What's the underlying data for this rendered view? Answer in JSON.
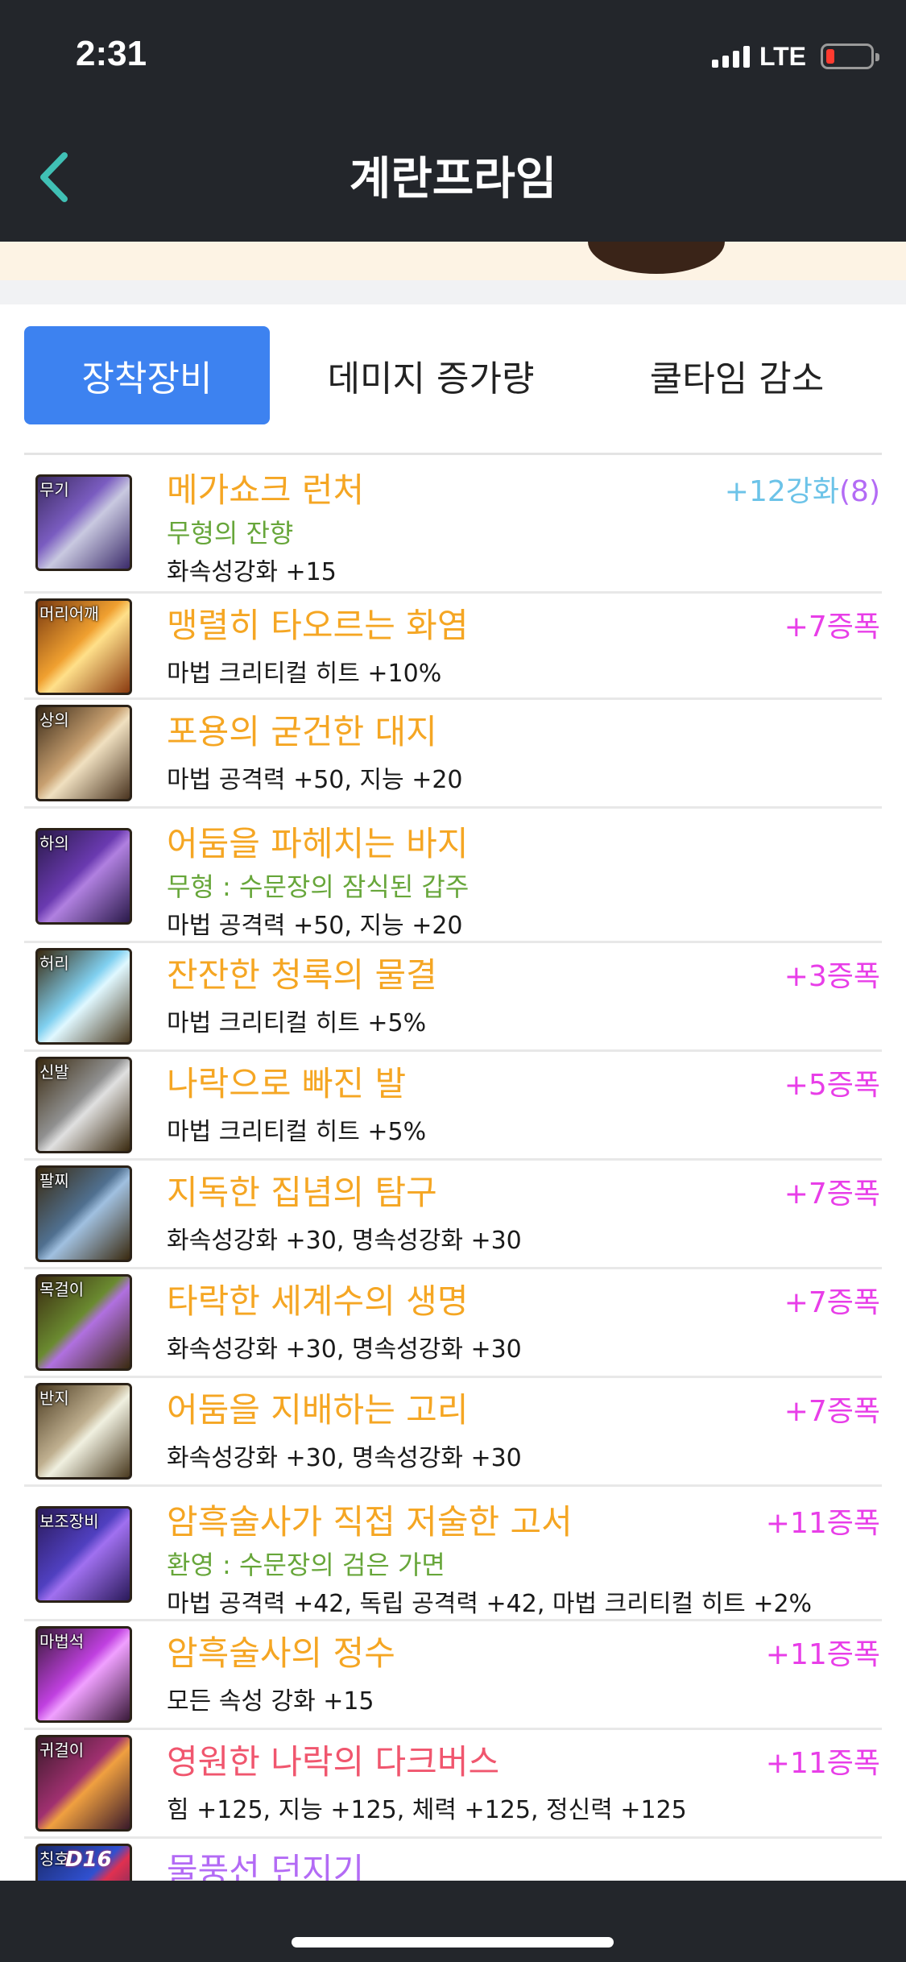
{
  "status": {
    "time": "2:31",
    "network": "LTE"
  },
  "nav": {
    "title": "계란프라임",
    "back_icon": "chevron-left-icon"
  },
  "tabs": [
    {
      "label": "장착장비",
      "active": true
    },
    {
      "label": "데미지 증가량",
      "active": false
    },
    {
      "label": "쿨타임 감소",
      "active": false
    }
  ],
  "colors": {
    "accent": "#3d82f0",
    "item_name_epic": "#f5a623",
    "item_name_legendary": "#f0566e",
    "item_name_rare": "#b36bf5",
    "sub_text": "#67a63a",
    "reinforce": "#6cc3e8",
    "amplify": "#e83ee8"
  },
  "equipment": [
    {
      "slot": "무기",
      "name": "메가쇼크 런처",
      "sub": "무형의 잔향",
      "stat": "화속성강화 +15",
      "grade": "+12강화",
      "grade_extra": "(8)"
    },
    {
      "slot": "머리어깨",
      "name": "맹렬히 타오르는 화염",
      "sub": "",
      "stat": "마법 크리티컬 히트 +10%",
      "grade": "+7증폭",
      "grade_extra": ""
    },
    {
      "slot": "상의",
      "name": "포용의 굳건한 대지",
      "sub": "",
      "stat": "마법 공격력 +50, 지능 +20",
      "grade": "",
      "grade_extra": ""
    },
    {
      "slot": "하의",
      "name": "어둠을 파헤치는 바지",
      "sub": "무형 : 수문장의 잠식된 갑주",
      "stat": "마법 공격력 +50, 지능 +20",
      "grade": "",
      "grade_extra": ""
    },
    {
      "slot": "허리",
      "name": "잔잔한 청록의 물결",
      "sub": "",
      "stat": "마법 크리티컬 히트 +5%",
      "grade": "+3증폭",
      "grade_extra": ""
    },
    {
      "slot": "신발",
      "name": "나락으로 빠진 발",
      "sub": "",
      "stat": "마법 크리티컬 히트 +5%",
      "grade": "+5증폭",
      "grade_extra": ""
    },
    {
      "slot": "팔찌",
      "name": "지독한 집념의 탐구",
      "sub": "",
      "stat": "화속성강화 +30, 명속성강화 +30",
      "grade": "+7증폭",
      "grade_extra": ""
    },
    {
      "slot": "목걸이",
      "name": "타락한 세계수의 생명",
      "sub": "",
      "stat": "화속성강화 +30, 명속성강화 +30",
      "grade": "+7증폭",
      "grade_extra": ""
    },
    {
      "slot": "반지",
      "name": "어둠을 지배하는 고리",
      "sub": "",
      "stat": "화속성강화 +30, 명속성강화 +30",
      "grade": "+7증폭",
      "grade_extra": ""
    },
    {
      "slot": "보조장비",
      "name": "암흑술사가 직접 저술한 고서",
      "sub": "환영 : 수문장의 검은 가면",
      "stat": "마법 공격력 +42, 독립 공격력 +42, 마법 크리티컬 히트 +2%",
      "grade": "+11증폭",
      "grade_extra": ""
    },
    {
      "slot": "마법석",
      "name": "암흑술사의 정수",
      "sub": "",
      "stat": "모든 속성 강화 +15",
      "grade": "+11증폭",
      "grade_extra": ""
    },
    {
      "slot": "귀걸이",
      "name": "영원한 나락의 다크버스",
      "sub": "",
      "stat": "힘 +125, 지능 +125, 체력 +125, 정신력 +125",
      "grade": "+11증폭",
      "grade_extra": ""
    },
    {
      "slot": "칭호",
      "name": "물풍선 던지기",
      "sub": "",
      "stat": "",
      "grade": "",
      "grade_extra": "",
      "icon_text": "D16"
    }
  ]
}
